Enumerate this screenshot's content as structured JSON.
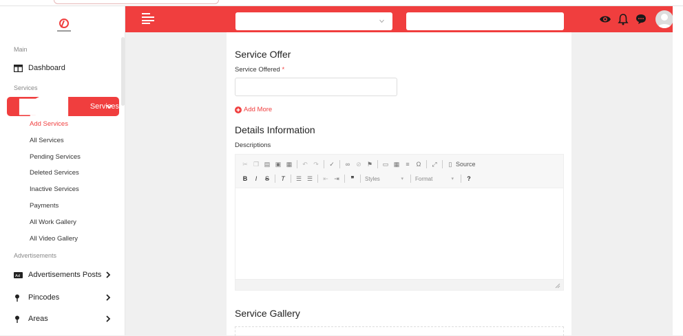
{
  "sidebar": {
    "sections": {
      "main": "Main",
      "services": "Services",
      "advertisements": "Advertisements"
    },
    "dashboard": "Dashboard",
    "services_menu": "Services",
    "sub_items": [
      "Add Services",
      "All Services",
      "Pending Services",
      "Deleted Services",
      "Inactive Services",
      "Payments",
      "All Work Gallery",
      "All Video Gallery"
    ],
    "ads_posts": "Advertisements Posts",
    "pincodes": "Pincodes",
    "areas": "Areas"
  },
  "form": {
    "service_offer_title": "Service Offer",
    "service_offered_label": "Service Offered",
    "required_mark": "*",
    "add_more": "Add More",
    "details_title": "Details Information",
    "descriptions_label": "Descriptions",
    "gallery_title": "Service Gallery"
  },
  "editor": {
    "source_label": "Source",
    "styles_label": "Styles",
    "format_label": "Format"
  },
  "colors": {
    "accent": "#f03e3e"
  },
  "icons": [
    "hamburger-icon",
    "eye-icon",
    "bell-icon",
    "chat-icon",
    "user-avatar"
  ]
}
